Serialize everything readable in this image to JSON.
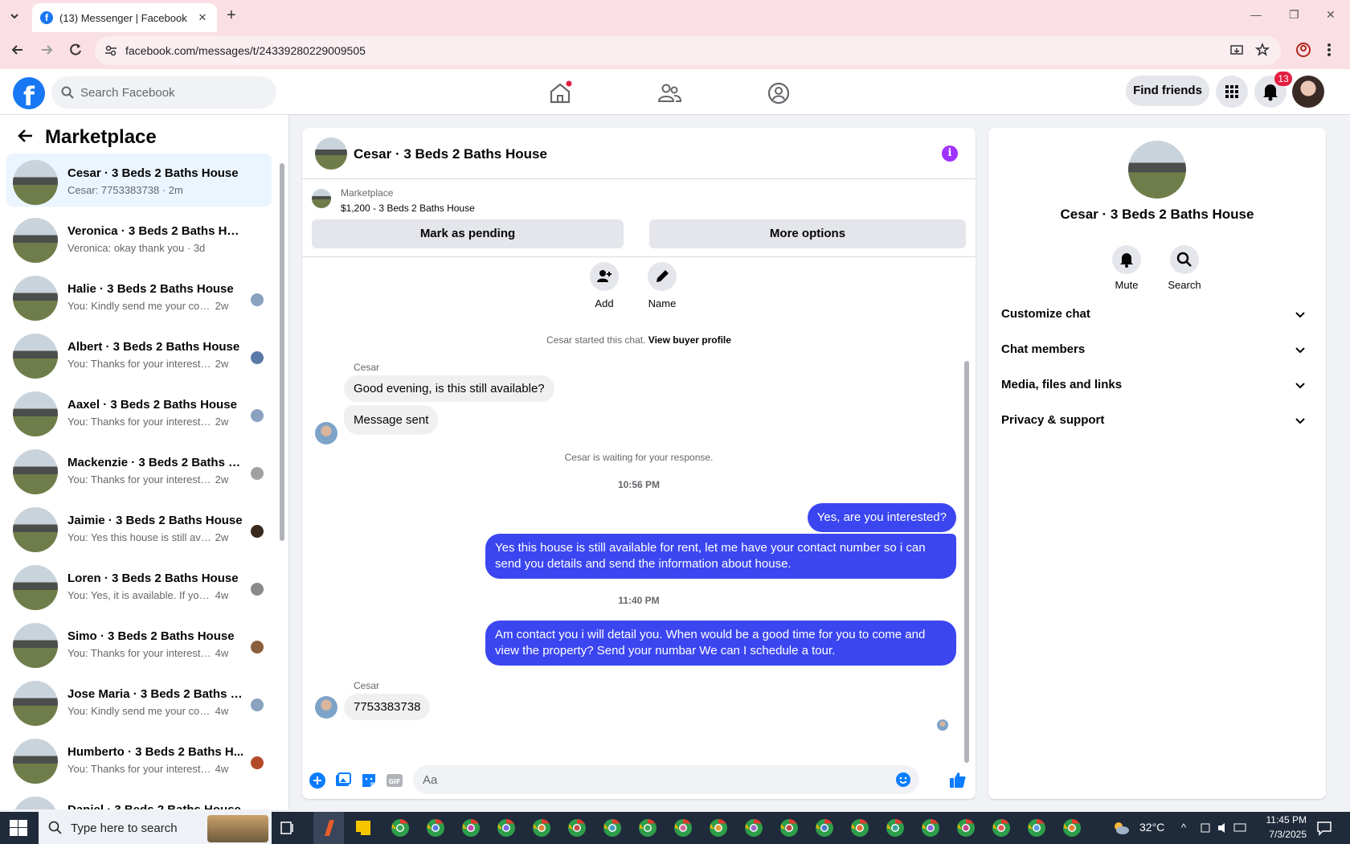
{
  "browser": {
    "tab_title": "(13) Messenger | Facebook",
    "url": "facebook.com/messages/t/24339280229009505",
    "colors": {
      "chrome_bg": "#fae0e4"
    }
  },
  "fb": {
    "search_placeholder": "Search Facebook",
    "find_friends": "Find friends",
    "notif_count": "13",
    "colors": {
      "brand": "#1877f2",
      "badge": "#e41e3f"
    }
  },
  "sidebar": {
    "title": "Marketplace",
    "items": [
      {
        "name": "Cesar · 3 Beds 2 Baths House",
        "preview": "Cesar: 7753383738",
        "time": "2m",
        "active": true
      },
      {
        "name": "Veronica · 3 Beds 2 Baths House",
        "preview": "Veronica: okay thank you",
        "time": "3d"
      },
      {
        "name": "Halie · 3 Beds 2 Baths House",
        "preview": "You: Kindly send me your contac...",
        "time": "2w"
      },
      {
        "name": "Albert · 3 Beds 2 Baths House",
        "preview": "You: Thanks for your interest in t...",
        "time": "2w"
      },
      {
        "name": "Aaxel · 3 Beds 2 Baths House",
        "preview": "You: Thanks for your interest in the...",
        "time": "2w"
      },
      {
        "name": "Mackenzie · 3 Beds 2 Baths H...",
        "preview": "You: Thanks for your interest in t...",
        "time": "2w"
      },
      {
        "name": "Jaimie · 3 Beds 2 Baths House",
        "preview": "You: Yes this house is still availa...",
        "time": "2w"
      },
      {
        "name": "Loren · 3 Beds 2 Baths House",
        "preview": "You: Yes, it is available. If you are...",
        "time": "4w"
      },
      {
        "name": "Simo · 3 Beds 2 Baths House",
        "preview": "You: Thanks for your interest in t...",
        "time": "4w"
      },
      {
        "name": "Jose Maria · 3 Beds 2 Baths H...",
        "preview": "You: Kindly send me your contac...",
        "time": "4w"
      },
      {
        "name": "Humberto · 3 Beds 2 Baths H...",
        "preview": "You: Thanks for your interest in t...",
        "time": "4w"
      },
      {
        "name": "Daniel · 3 Beds 2 Baths House",
        "preview": "",
        "time": ""
      }
    ]
  },
  "chat": {
    "title": "Cesar · 3 Beds 2 Baths House",
    "marketplace_label": "Marketplace",
    "price_line": "$1,200 - 3 Beds 2 Baths House",
    "btn_pending": "Mark as pending",
    "btn_more": "More options",
    "act_add": "Add",
    "act_name": "Name",
    "started_text": "Cesar started this chat.",
    "view_profile": "View buyer profile",
    "sender1": "Cesar",
    "msg1": "Good evening, is this still available?",
    "msg2": "Message sent",
    "waiting": "Cesar is waiting for your response.",
    "time1": "10:56 PM",
    "out1": "Yes, are you interested?",
    "out2": "Yes this house is still available for rent, let me have your contact number so i can send you details and send the information about house.",
    "time2": "11:40 PM",
    "out3": "Am contact you i will detail you.  When would be a good time for you to come and view the property? Send your numbar We can I schedule a tour.",
    "sender2": "Cesar",
    "msg3": "7753383738",
    "composer_placeholder": "Aa",
    "colors": {
      "outgoing": "#3b46f0",
      "incoming": "#f0f0f0",
      "info": "#a033ff"
    }
  },
  "rpanel": {
    "title": "Cesar · 3 Beds 2 Baths House",
    "mute": "Mute",
    "search": "Search",
    "rows": [
      "Customize chat",
      "Chat members",
      "Media, files and links",
      "Privacy & support"
    ]
  },
  "taskbar": {
    "search_placeholder": "Type here to search",
    "weather": "32°C",
    "time": "11:45 PM",
    "date": "7/3/2025"
  }
}
